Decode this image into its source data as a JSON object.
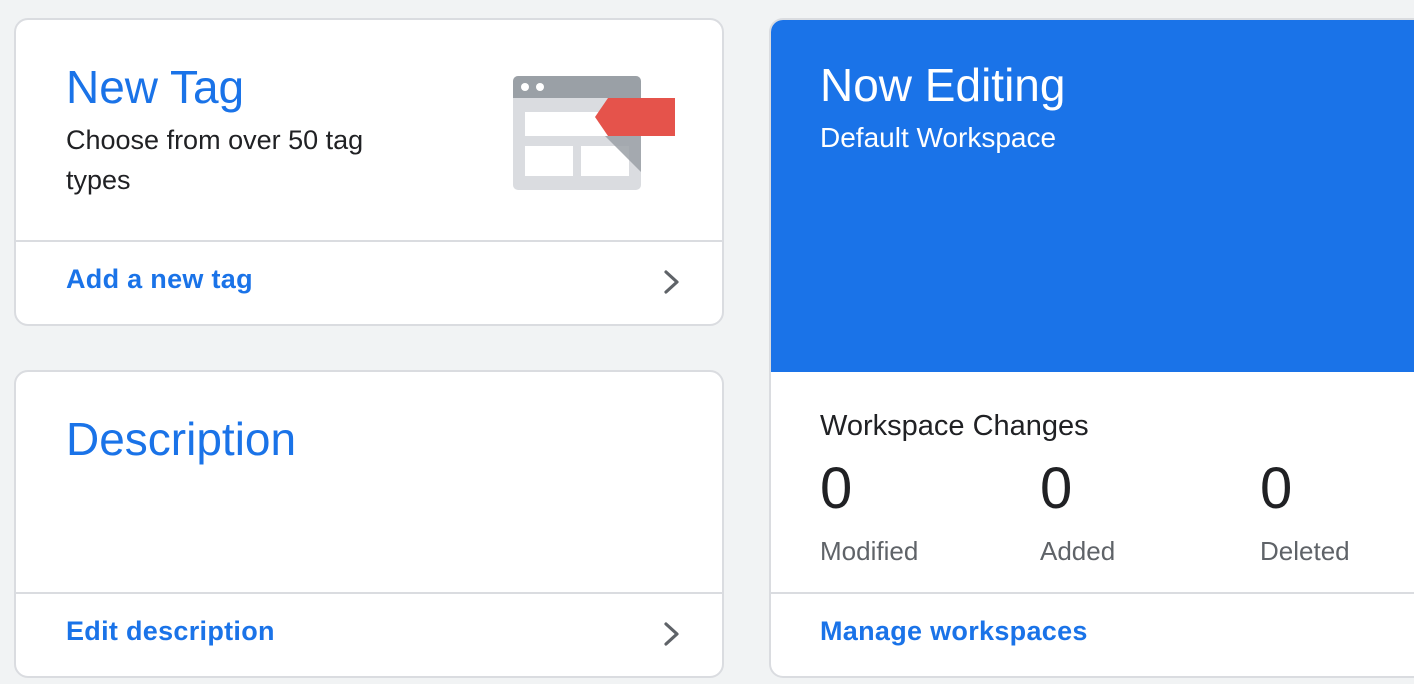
{
  "new_tag": {
    "title": "New Tag",
    "subtitle": "Choose from over 50 tag types",
    "link": "Add a new tag",
    "illustration_icon": "tag-page-illustration"
  },
  "description": {
    "title": "Description",
    "link": "Edit description"
  },
  "workspace": {
    "header_title": "Now Editing",
    "name": "Default Workspace",
    "changes_title": "Workspace Changes",
    "stats": [
      {
        "value": "0",
        "label": "Modified"
      },
      {
        "value": "0",
        "label": "Added"
      },
      {
        "value": "0",
        "label": "Deleted"
      }
    ],
    "link": "Manage workspaces"
  },
  "colors": {
    "accent_blue": "#1a73e8",
    "tag_red": "#e5534b",
    "background": "#f1f3f4",
    "border": "#dadce0"
  }
}
